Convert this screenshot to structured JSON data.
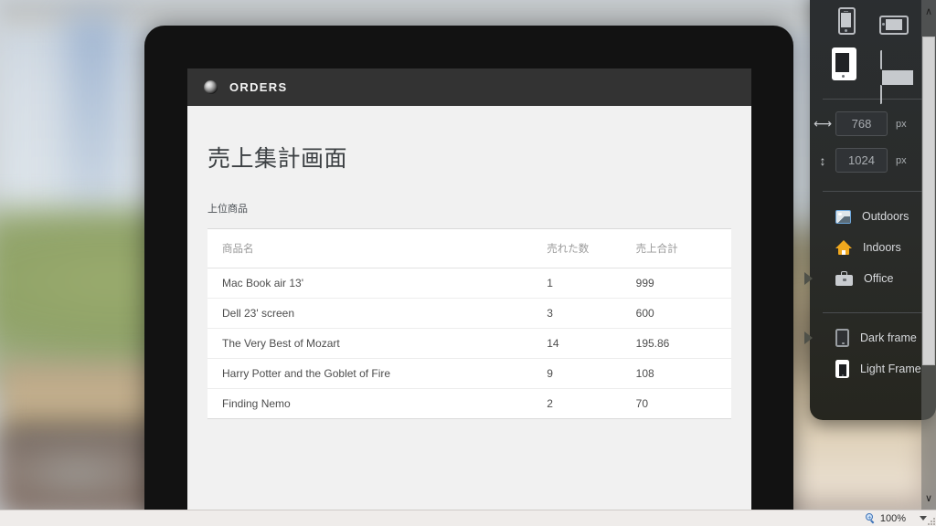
{
  "device_preview": {
    "app_header": {
      "icon": "disc-icon",
      "title": "ORDERS"
    },
    "page_title": "売上集計画面",
    "section_label": "上位商品",
    "table": {
      "columns": [
        "商品名",
        "売れた数",
        "売上合計"
      ],
      "rows": [
        {
          "name": "Mac Book air 13'",
          "qty": "1",
          "total": "999"
        },
        {
          "name": "Dell 23' screen",
          "qty": "3",
          "total": "600"
        },
        {
          "name": "The Very Best of Mozart",
          "qty": "14",
          "total": "195.86"
        },
        {
          "name": "Harry Potter and the Goblet of Fire",
          "qty": "9",
          "total": "108"
        },
        {
          "name": "Finding Nemo",
          "qty": "2",
          "total": "70"
        }
      ]
    }
  },
  "tool_panel": {
    "devices": [
      {
        "name": "phone-portrait",
        "selected": false
      },
      {
        "name": "phone-landscape",
        "selected": false
      },
      {
        "name": "tablet-portrait",
        "selected": true
      },
      {
        "name": "desktop",
        "selected": false
      }
    ],
    "size": {
      "width_value": "768",
      "width_unit": "px",
      "width_icon": "horizontal-arrow-icon",
      "height_value": "1024",
      "height_unit": "px",
      "height_icon": "vertical-arrow-icon"
    },
    "backgrounds": [
      {
        "label": "Outdoors",
        "icon": "image-icon",
        "marked": false
      },
      {
        "label": "Indoors",
        "icon": "house-icon",
        "marked": false
      },
      {
        "label": "Office",
        "icon": "briefcase-icon",
        "marked": true
      }
    ],
    "frames": [
      {
        "label": "Dark frame",
        "icon": "tablet-dark-icon",
        "marked": true
      },
      {
        "label": "Light Frame",
        "icon": "tablet-light-icon",
        "marked": false
      }
    ]
  },
  "scrollbar": {
    "up_glyph": "∧",
    "down_glyph": "∨"
  },
  "statusbar": {
    "zoom_icon": "magnifier-plus-icon",
    "zoom_level": "100%",
    "zoom_plus": "+"
  },
  "colors": {
    "panel_bg": "#2b2e31",
    "app_header_bg": "#333333",
    "screen_bg": "#f1f1f1",
    "accent_blue": "#6fa8dc",
    "accent_orange": "#f0a81e",
    "statusbar_bg": "#efecea"
  }
}
